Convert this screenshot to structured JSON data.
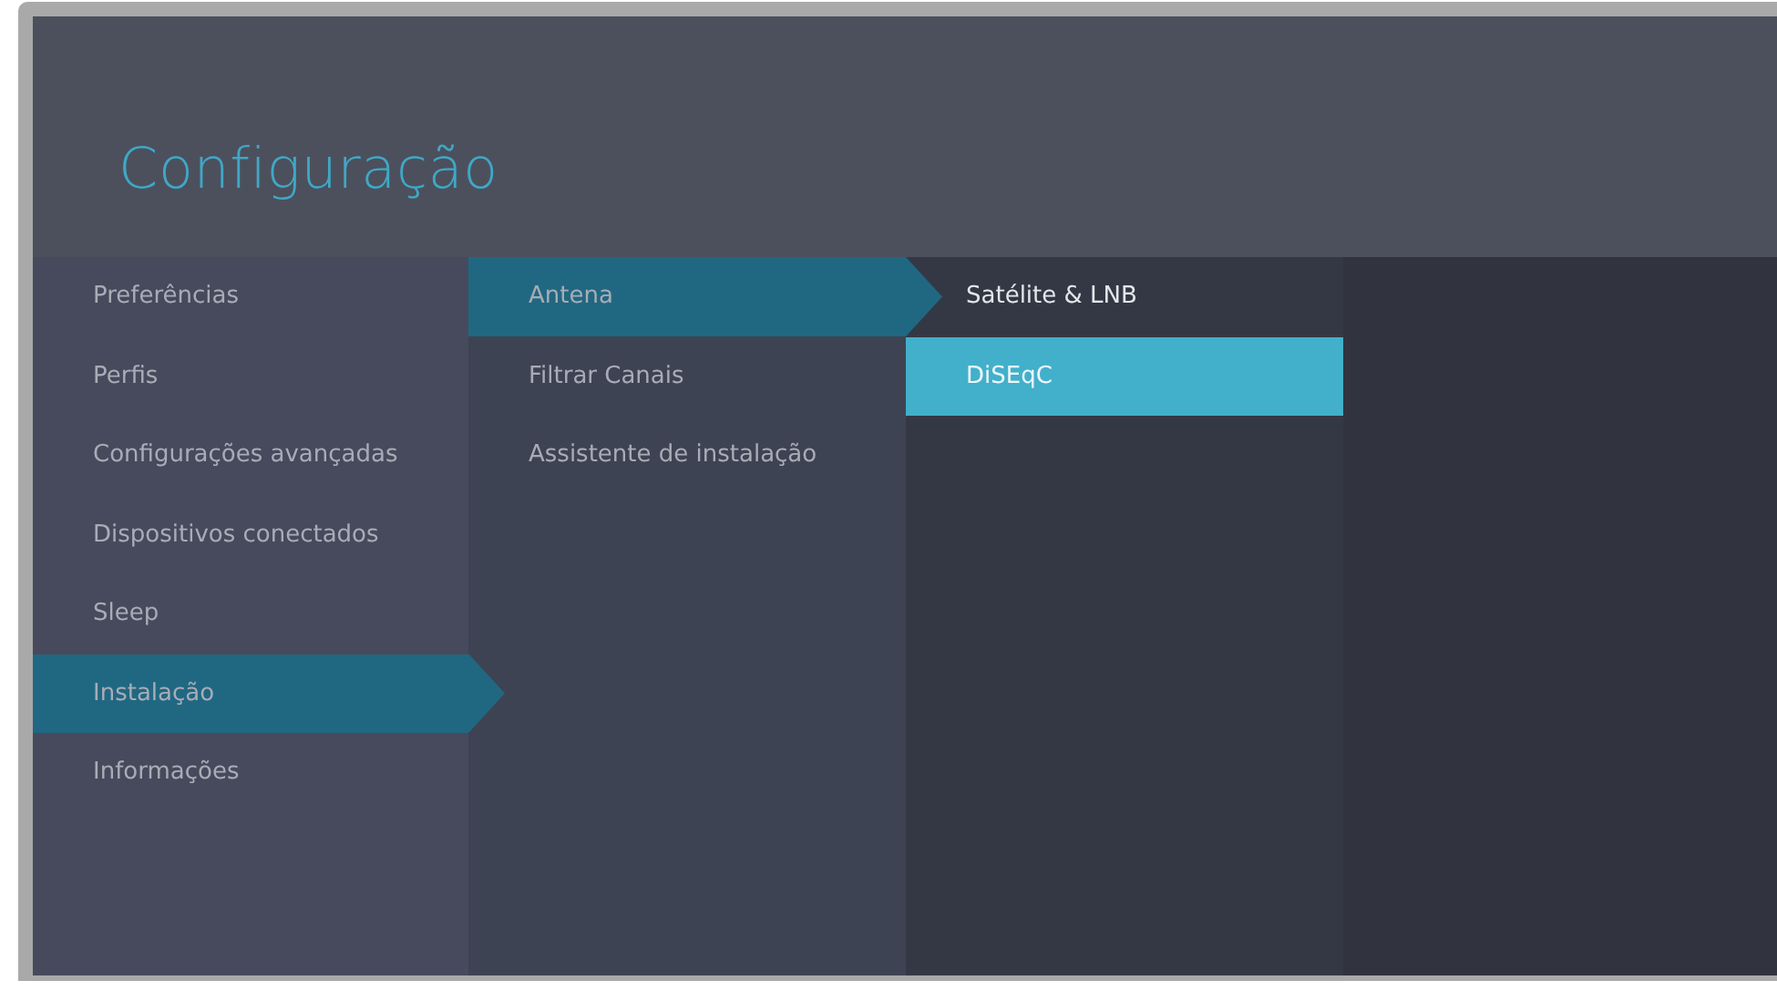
{
  "header": {
    "title": "Configuração"
  },
  "columns": [
    {
      "active": false,
      "items": [
        {
          "label": "Preferências",
          "selected": false
        },
        {
          "label": "Perfis",
          "selected": false
        },
        {
          "label": "Configurações avançadas",
          "selected": false
        },
        {
          "label": "Dispositivos conectados",
          "selected": false
        },
        {
          "label": "Sleep",
          "selected": false
        },
        {
          "label": "Instalação",
          "selected": true
        },
        {
          "label": "Informações",
          "selected": false
        }
      ]
    },
    {
      "active": false,
      "items": [
        {
          "label": "Antena",
          "selected": true
        },
        {
          "label": "Filtrar Canais",
          "selected": false
        },
        {
          "label": "Assistente de instalação",
          "selected": false
        }
      ]
    },
    {
      "active": true,
      "items": [
        {
          "label": "Satélite & LNB",
          "selected": false
        },
        {
          "label": "DiSEqC",
          "selected": true
        }
      ]
    }
  ]
}
